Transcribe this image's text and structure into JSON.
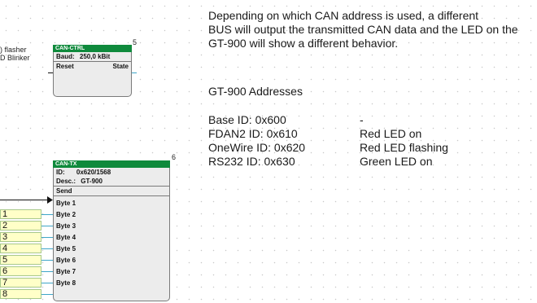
{
  "left_labels": [
    ") flasher",
    "D Blinker"
  ],
  "ctrl_block": {
    "number": "5",
    "title": "CAN-CTRL",
    "baud_label": "Baud:",
    "baud_value": "250,0 kBit",
    "reset_label": "Reset",
    "state_label": "State"
  },
  "tx_block": {
    "number": "6",
    "title": "CAN-TX",
    "id_label": "ID:",
    "id_value": "0x620/1568",
    "desc_label": "Desc.:",
    "desc_value": "GT-900",
    "send_label": "Send",
    "bytes": [
      "Byte 1",
      "Byte 2",
      "Byte 3",
      "Byte 4",
      "Byte 5",
      "Byte 6",
      "Byte 7",
      "Byte 8"
    ]
  },
  "inputs": [
    "1",
    "2",
    "3",
    "4",
    "5",
    "6",
    "7",
    "8"
  ],
  "description": [
    "Depending on which CAN address is used, a different",
    "BUS will output the transmitted CAN data and the LED on the",
    "GT-900 will show a different behavior."
  ],
  "addresses": {
    "heading": "GT-900 Addresses",
    "rows": [
      {
        "id": "Base ID: 0x600",
        "effect": "-"
      },
      {
        "id": "FDAN2 ID: 0x610",
        "effect": "Red LED on"
      },
      {
        "id": "OneWire ID: 0x620",
        "effect": "Red LED flashing"
      },
      {
        "id": "RS232 ID: 0x630",
        "effect": "Green LED on"
      }
    ]
  }
}
